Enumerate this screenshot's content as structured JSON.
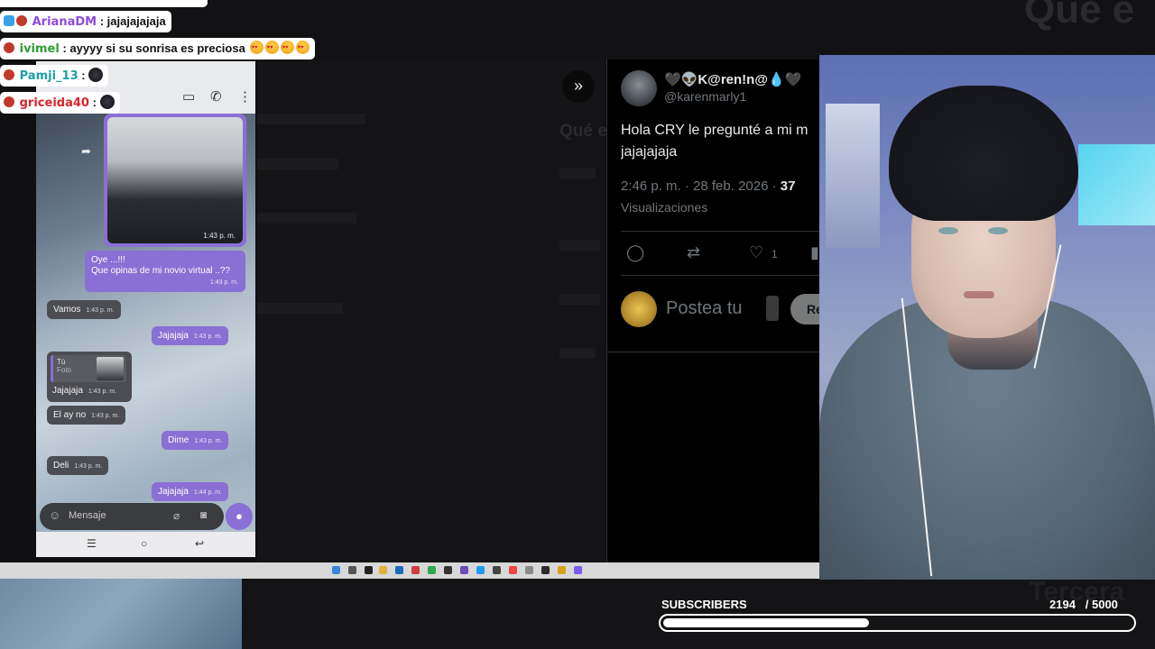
{
  "chat": [
    {
      "user": "ArianaDM",
      "message": ": jajajajajaja",
      "user_color": "#8d4bd6"
    },
    {
      "user": "ivimel",
      "message": ": ayyyy si su sonrisa es preciosa",
      "user_color": "#2e9d2e"
    },
    {
      "user": "Pamji_13",
      "message": ":",
      "user_color": "#1f9fa8"
    },
    {
      "user": "griceida40",
      "message": ":",
      "user_color": "#d6262e"
    }
  ],
  "phone": {
    "bubbles": [
      {
        "text": "Oye ...!!!\nQue opinas de mi novio virtual ..??",
        "time": "1:43 p. m."
      },
      {
        "text": "Vamos",
        "time": "1:43 p. m."
      },
      {
        "text": "Jajajaja",
        "time": "1:43 p. m."
      },
      {
        "text": "Jajajaja",
        "time": "1:43 p. m."
      },
      {
        "text": "El ay no",
        "time": "1:43 p. m."
      },
      {
        "text": "Dime",
        "time": "1:43 p. m."
      },
      {
        "text": "Deli",
        "time": "1:43 p. m."
      },
      {
        "text": "Jajajaja",
        "time": "1:44 p. m."
      }
    ],
    "photo_time": "1:43 p. m.",
    "reply_quote": {
      "author": "Tú",
      "kind": "Foto"
    },
    "compose_placeholder": "Mensaje"
  },
  "tweet": {
    "display_name": "🖤👽K@ren!n@💧🖤",
    "handle": "@karenmarly1",
    "text": "Hola CRY le pregunté a mi m\njajajajaja",
    "time": "2:46 p. m. · 28 feb. 2026 · ",
    "views_count": "37",
    "views_label": "Visualizaciones",
    "like_count": "1",
    "reply_placeholder": "Postea tu",
    "reply_button": "Re"
  },
  "background": {
    "heading_right": "Qué e",
    "heading_ghost": "Qué e",
    "heading_bottom": "Tercera"
  },
  "subscribers": {
    "label": "SUBSCRIBERS",
    "current": 2194,
    "goal": 5000,
    "count_text": "2194   / 5000"
  }
}
